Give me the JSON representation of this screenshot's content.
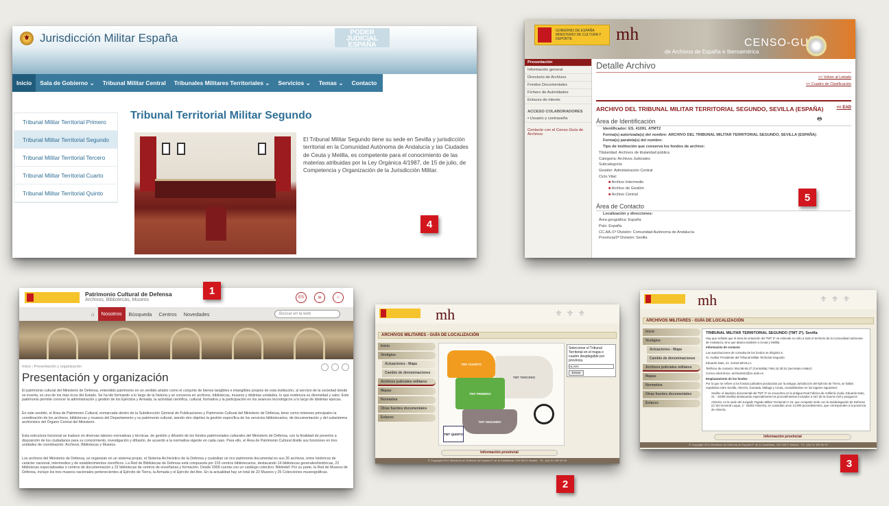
{
  "badges": {
    "b1": "1",
    "b2": "2",
    "b3": "3",
    "b4": "4",
    "b5": "5"
  },
  "shot4": {
    "site_title": "Jurisdicción Militar España",
    "poder_judicial": "PODER JUDICIAL ESPAÑA",
    "nav": [
      "Inicio",
      "Sala de Gobierno ⌄",
      "Tribunal Militar Central",
      "Tribunales Militares Territoriales ⌄",
      "Servicios ⌄",
      "Temas ⌄",
      "Contacto"
    ],
    "sidebar": [
      "Tribunal Militar Territorial Primero",
      "Tribunal Militar Territorial Segundo",
      "Tribunal Militar Territorial Tercero",
      "Tribunal Militar Territorial Cuarto",
      "Tribunal Militar Territorial Quinto"
    ],
    "heading": "Tribunal Territorial Militar Segundo",
    "body": "El Tribunal Militar Segundo tiene su sede en Sevilla y jurisdicción territorial en la Comunidad Autónoma de Andalucía y las Ciudades de Ceuta y Melilla, es competente para el conocimiento de las materias atribuidas por la Ley Orgánica 4/1987, de 15 de julio, de Competencia y Organización de la Jurisdicción Militar."
  },
  "shot5": {
    "gobierno": "GOBIERNO DE ESPAÑA MINISTERIO DE CULTURA Y DEPORTE",
    "logo": "mh",
    "censo": "CENSO-GUÍA",
    "censo_sub": "de Archivos de España e Iberoamérica",
    "menu": [
      "Presentación",
      "Información general",
      "Directorio de Archivos",
      "Fondos Documentales",
      "Fichero de Autoridades",
      "Enlaces de interés"
    ],
    "acceso": "ACCESO COLABORADORES",
    "usuario": "Usuario y contraseña",
    "contacto": "Contacte con el Censo-Guía de Archivos",
    "detalle": "Detalle Archivo",
    "volver": "<< Volver al Listado",
    "cuadro": "<< Cuadro de Clasificación",
    "archivo": "ARCHIVO DEL TRIBUNAL MILITAR TERRITORIAL SEGUNDO, SEVILLA (ESPAÑA)",
    "ead": "<< EAD",
    "area_id": "Área de Identificación",
    "lines": [
      "Identificador: ES. 41091. ATMT2",
      "Forma(s) autorizada(s) del nombre: ARCHIVO DEL TRIBUNAL MILITAR TERRITORIAL SEGUNDO, SEVILLA (ESPAÑA)",
      "Forma(s) paralela(s) del nombre:",
      "Tipo de institución que conserva los fondos de archivo:",
      "Titularidad: Archivos de titularidad pública",
      "Categoría: Archivos Judiciales",
      "Subcategoría:",
      "Gestión: Administración Central",
      "Ciclo Vital:"
    ],
    "ciclo": [
      "Archivo Intermedio",
      "Archivo de Gestión",
      "Archivo Central"
    ],
    "area_contacto": "Área de Contacto",
    "contact_lines": [
      "Localización y direcciones:",
      "Área geográfica: España",
      "País: España",
      "CC.AA./1ª División: Comunidad Autónoma de Andalucía",
      "Provincia/2ª División: Sevilla"
    ]
  },
  "shot1": {
    "site": "Patrimonio Cultural de Defensa",
    "site_sub": "Archivos, Bibliotecas, Museos",
    "lang": "ES",
    "nav": [
      "Nosotros",
      "Búsqueda",
      "Centros",
      "Novedades"
    ],
    "search_placeholder": "Buscar en la web",
    "crumb": "Inicio › Presentación y organización",
    "heading": "Presentación y organización",
    "p1": "El patrimonio cultural del Ministerio de Defensa, entendido patrimonio en un sentido amplio como el conjunto de bienes tangibles e intangibles propios de esta institución, al servicio de la sociedad donde se inserta, es uno de los más ricos del Estado. Se ha ido formando a lo largo de la historia y se conserva en archivos, bibliotecas, museos y distintas unidades, lo que evidencia su diversidad y valor. Este patrimonio permite conocer la administración y gestión de los Ejércitos y Armada, la actividad científica, cultural, formativa y la participación en los avances tecnológicos a lo largo de distintas épocas.",
    "p2": "En este sentido, el Área de Patrimonio Cultural, enmarcada dentro de la Subdirección General de Publicaciones y Patrimonio Cultural del Ministerio de Defensa, tiene como misiones principales la coordinación de los archivos, bibliotecas y museos del Departamento y su patrimonio cultural, siendo otro objetivo la gestión específica de los servicios bibliotecarios, de documentación y del subsistema archivístico del Órgano Central del Ministerio.",
    "p3": "Esta estructura funcional se traduce en diversas labores normativas y técnicas, de gestión y difusión de los fondos patrimoniales culturales del Ministerio de Defensa, con la finalidad de ponerlos a disposición de los ciudadanos para su conocimiento, investigación y difusión, de acuerdo a la normativa vigente en cada caso. Para ello, el Área de Patrimonio Cultural divide sus funciones en tres unidades de coordinación: Archivos, Bibliotecas y Museos.",
    "p4": "Los archivos del Ministerio de Defensa, se organizan en un sistema propio, el Sistema Archivístico de la Defensa y custodian un rico patrimonio documental en sus 26 archivos, entre históricos de carácter nacional, intermedios y de establecimientos científicos. La Red de Bibliotecas de Defensa está compuesta por 215 centros bibliotecarios, destacando 14 bibliotecas generales/históricas, 22 bibliotecas especializadas o centros de documentación y 22 bibliotecas de centros de enseñanza y formación. Desde 2009 cuenta con un catálogo colectivo. Bibliodef. Por su parte, la Red de Museos de Defensa, incluye los tres museos nacionales pertenecientes al Ejército de Tierra, la Armada y el Ejército del Aire. En la actualidad hay un total de 22 Museos y 25 Colecciones museográficas."
  },
  "shot2": {
    "logo": "mh",
    "title": "ARCHIVOS MILITARES - GUÍA DE LOCALIZACIÓN",
    "menu": [
      "Inicio",
      "Vestigios",
      "Actuaciones - Mapa",
      "Cambio de denominaciones",
      "Archivos judiciales militares",
      "Mapas",
      "Normativa",
      "Otras fuentes documentales",
      "Enlaces"
    ],
    "regions": [
      "TMT CUARTO",
      "TMT TERCERO",
      "TMT PRIMERO",
      "TMT SEGUNDO",
      "TMT QUINTO"
    ],
    "select_text": "Seleccione el Tribunal Territorial en el mapa o cuadro desplegable por provincia.",
    "select_value": "ALAVA",
    "select_btn": "Enviar",
    "info": "Información provincial",
    "footer": "© Copyright 2011 Ministerio de Defensa de España P. de la Castellana, 109 28071 Madrid - Tlf.: (34) 91 395 50 00"
  },
  "shot3": {
    "logo": "mh",
    "title": "ARCHIVOS MILITARES - GUÍA DE LOCALIZACIÓN",
    "menu": [
      "Inicio",
      "Vestigios",
      "Actuaciones - Mapa",
      "Cambio de denominaciones",
      "Archivos judiciales militares",
      "Mapas",
      "Normativa",
      "Otras fuentes documentales",
      "Enlaces"
    ],
    "heading": "TRIBUNAL MILITAR TERRITORIAL SEGUNDO (TMT 2º). Sevilla",
    "lines": [
      "Hay que señalar que el área de actuación del TMT 2º se extiende no sólo a todo el territorio de la Comunidad Autónoma de Andalucía, sino que abarca también a Ceuta y Melilla",
      "Información de contacto",
      "Las autorizaciones de consulta de los fondos se dirigirán a:",
      "Sr. Auditor Presidente del Tribunal Militar Territorial Segundo",
      "Eduardo Dato, 21. 41018 SEVILLA",
      "Teléfono de contacto: 954.98.85.27 (Centralita) / 954.42.30.51 (secretario relator)",
      "Correo electrónico: archivotmt2@oc.mde.es",
      "Emplazamiento de los fondos",
      "Por lo que se refiere a los fondos judiciales producidos por la antigua Jurisdicción del Ejército de Tierra, se hallan repartidos entre Sevilla, Almería, Granada, Málaga y Ceuta, custodiándose en los lugares siguientes:",
      "Sevilla: el depósito documental del TMT 2º se encuentra en la antigua Real Fábrica de Artillería (Avda. Eduardo Dato, 21 - 41005 Sevilla) destacando especialmente los procedimientos incoados a raíz de la Guerra civil y posguerra",
      "Almería: en la sede del Juzgado Togado Militar Territorial nº 23, que comparte sede con la Subdelegación de Defensa (C/ del General Luque, 2 - 04002 Almería), se custodian unos 14.000 procedimientos, que corresponden a la provincia de Almería."
    ],
    "info": "Información provincial",
    "footer": "© Copyright 2011 Ministerio de Defensa de España P. de la Castellana, 109 28071 Madrid - Tlf.: (34) 91 395 50 00"
  }
}
